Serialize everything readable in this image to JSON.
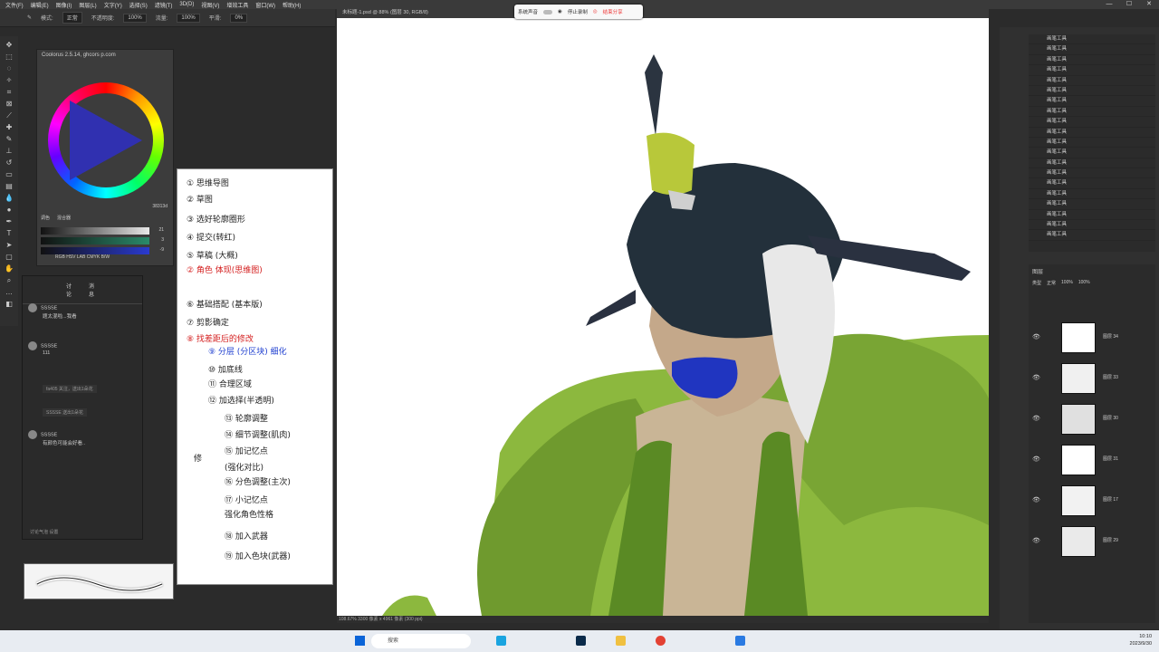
{
  "menubar": {
    "items": [
      "文件(F)",
      "编辑(E)",
      "图像(I)",
      "图层(L)",
      "文字(Y)",
      "选择(S)",
      "滤镜(T)",
      "3D(D)",
      "视图(V)",
      "增效工具",
      "窗口(W)",
      "帮助(H)"
    ]
  },
  "options": {
    "mode_label": "模式:",
    "mode": "正常",
    "opacity_label": "不透明度:",
    "opacity": "100%",
    "flow_label": "流量:",
    "flow": "100%",
    "smooth_label": "平滑:",
    "smooth": "0%"
  },
  "coolorus": {
    "title": "Coolorus 2.5.14, ghcors p.com",
    "value_label": "38313d",
    "tab_a": "调色",
    "tab_b": "混合器",
    "modes": [
      "RGB",
      "HSV",
      "LAB",
      "CMYK",
      "B/W"
    ],
    "sliders": [
      {
        "color": "#e8e8e8",
        "value": "21"
      },
      {
        "color": "#2a8a6a",
        "value": "3"
      },
      {
        "color": "#2a3ad0",
        "value": "-9"
      }
    ],
    "accent": "#1f66ff"
  },
  "notes": {
    "lines": [
      {
        "text": "① 思维导图",
        "cls": ""
      },
      {
        "text": "② 草图",
        "cls": ""
      },
      {
        "text": "③ 选好轮廓圈形",
        "cls": ""
      },
      {
        "text": "④ 提交(转红)",
        "cls": ""
      },
      {
        "text": "⑤ 草稿 (大概)",
        "cls": ""
      },
      {
        "text": "② 角色 体现(思维图)",
        "cls": "red"
      },
      {
        "text": "⑥ 基础搭配 (基本版)",
        "cls": ""
      },
      {
        "text": "⑦ 剪影确定",
        "cls": ""
      },
      {
        "text": "⑧ 找差距后的修改",
        "cls": "red"
      },
      {
        "text": "⑨ 分层 (分区块) 细化",
        "cls": "blue"
      },
      {
        "text": "⑩ 加底线",
        "cls": ""
      },
      {
        "text": "⑪ 合理区域",
        "cls": ""
      },
      {
        "text": "⑫ 加选择(半透明)",
        "cls": ""
      },
      {
        "text": "⑬ 轮廓调整",
        "cls": ""
      },
      {
        "text": "⑭ 细节调整(肌肉)",
        "cls": ""
      },
      {
        "text": "⑮ 加记忆点",
        "cls": ""
      },
      {
        "text": "(强化对比)",
        "cls": ""
      },
      {
        "text": "⑯ 分色调整(主次)",
        "cls": ""
      },
      {
        "text": "⑰ 小记忆点",
        "cls": ""
      },
      {
        "text": "强化角色性格",
        "cls": ""
      },
      {
        "text": "⑱ 加入武器",
        "cls": ""
      },
      {
        "text": "⑲ 加入色块(武器)",
        "cls": ""
      }
    ],
    "side_note": "修"
  },
  "chat": {
    "tab_a": "讨论",
    "tab_b": "消息",
    "messages": [
      {
        "user": "SSSSE",
        "text": "题太混啦...我看"
      },
      {
        "user": "SSSSE",
        "text": "111"
      },
      {
        "user": "SSSSE",
        "text": "有颜色可能会好看.."
      }
    ],
    "system": [
      "fa405 关注，送出1朵花",
      "SSSSE 送出1朵花"
    ],
    "footer": "讨论气泡    设置"
  },
  "doc": {
    "tab_title": "未标题-1.psd @ 88% (图层 30, RGB/8)",
    "status": "108.67%   3300 像素 x 4961 像素 (300 ppi)"
  },
  "recording": {
    "sound_label": "系统声音",
    "stop_label": "停止录制",
    "pause_label": "结束分享"
  },
  "history": {
    "items": [
      "画笔工具",
      "画笔工具",
      "画笔工具",
      "画笔工具",
      "画笔工具",
      "画笔工具",
      "画笔工具",
      "画笔工具",
      "画笔工具",
      "画笔工具",
      "画笔工具",
      "画笔工具",
      "画笔工具",
      "画笔工具",
      "画笔工具",
      "画笔工具",
      "画笔工具",
      "画笔工具",
      "画笔工具",
      "画笔工具"
    ]
  },
  "layers": {
    "header": "图层",
    "kind_label": "类型",
    "blend": "正常",
    "opacity": "100%",
    "fill": "100%",
    "list": [
      {
        "name": "图层 34"
      },
      {
        "name": "图层 33"
      },
      {
        "name": "图层 30"
      },
      {
        "name": "图层 31"
      },
      {
        "name": "图层 17"
      },
      {
        "name": "图层 29"
      }
    ]
  },
  "taskbar": {
    "search": "搜索",
    "time": "10:10",
    "date": "2023/9/30"
  }
}
